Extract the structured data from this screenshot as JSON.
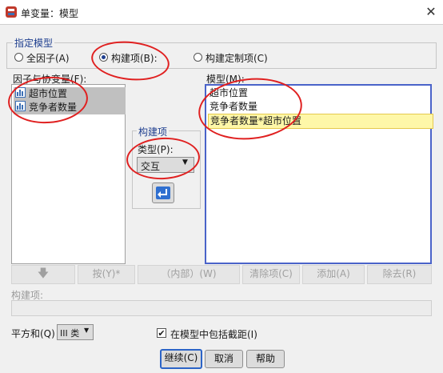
{
  "window": {
    "title": "单变量：模型",
    "close_glyph": "✕"
  },
  "specify_model": {
    "legend": "指定模型",
    "options": [
      {
        "label": "全因子(A)",
        "selected": false
      },
      {
        "label": "构建项(B):",
        "selected": true
      },
      {
        "label": "构建定制项(C)",
        "selected": false
      }
    ]
  },
  "factors": {
    "label": "因子与协变量(F):",
    "items": [
      "超市位置",
      "竞争者数量"
    ]
  },
  "model": {
    "label": "模型(M):",
    "items": [
      "超市位置",
      "竞争者数量",
      "竞争者数量*超市位置"
    ]
  },
  "build_term": {
    "legend": "构建项",
    "type_label": "类型(P):",
    "type_value": "交互",
    "move_icon": "arrow-right-icon"
  },
  "term_buttons": [
    "按(Y)*",
    "（内部）(W)",
    "清除项(C)",
    "添加(A)",
    "除去(R)"
  ],
  "term_field": {
    "label": "构建项:",
    "value": ""
  },
  "sum_of_squares": {
    "label": "平方和(Q)",
    "value": "III 类"
  },
  "intercept": {
    "label": "在模型中包括截距(I)",
    "checked": true
  },
  "footer": {
    "continue": "继续(C)",
    "cancel": "取消",
    "help": "帮助"
  },
  "colors": {
    "accent": "#2c64c7",
    "annotation": "#e02020",
    "highlight": "#fef7a8"
  }
}
